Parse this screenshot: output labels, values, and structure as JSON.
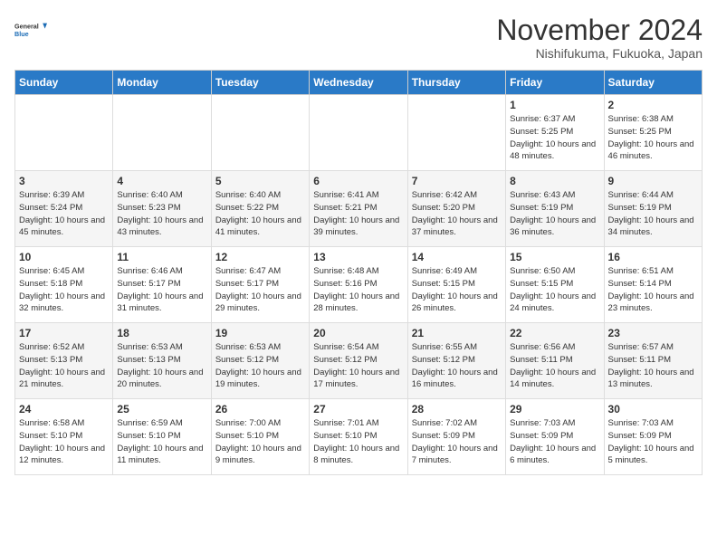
{
  "header": {
    "logo_line1": "General",
    "logo_line2": "Blue",
    "month": "November 2024",
    "location": "Nishifukuma, Fukuoka, Japan"
  },
  "days_of_week": [
    "Sunday",
    "Monday",
    "Tuesday",
    "Wednesday",
    "Thursday",
    "Friday",
    "Saturday"
  ],
  "weeks": [
    [
      {
        "day": "",
        "info": ""
      },
      {
        "day": "",
        "info": ""
      },
      {
        "day": "",
        "info": ""
      },
      {
        "day": "",
        "info": ""
      },
      {
        "day": "",
        "info": ""
      },
      {
        "day": "1",
        "info": "Sunrise: 6:37 AM\nSunset: 5:25 PM\nDaylight: 10 hours\nand 48 minutes."
      },
      {
        "day": "2",
        "info": "Sunrise: 6:38 AM\nSunset: 5:25 PM\nDaylight: 10 hours\nand 46 minutes."
      }
    ],
    [
      {
        "day": "3",
        "info": "Sunrise: 6:39 AM\nSunset: 5:24 PM\nDaylight: 10 hours\nand 45 minutes."
      },
      {
        "day": "4",
        "info": "Sunrise: 6:40 AM\nSunset: 5:23 PM\nDaylight: 10 hours\nand 43 minutes."
      },
      {
        "day": "5",
        "info": "Sunrise: 6:40 AM\nSunset: 5:22 PM\nDaylight: 10 hours\nand 41 minutes."
      },
      {
        "day": "6",
        "info": "Sunrise: 6:41 AM\nSunset: 5:21 PM\nDaylight: 10 hours\nand 39 minutes."
      },
      {
        "day": "7",
        "info": "Sunrise: 6:42 AM\nSunset: 5:20 PM\nDaylight: 10 hours\nand 37 minutes."
      },
      {
        "day": "8",
        "info": "Sunrise: 6:43 AM\nSunset: 5:19 PM\nDaylight: 10 hours\nand 36 minutes."
      },
      {
        "day": "9",
        "info": "Sunrise: 6:44 AM\nSunset: 5:19 PM\nDaylight: 10 hours\nand 34 minutes."
      }
    ],
    [
      {
        "day": "10",
        "info": "Sunrise: 6:45 AM\nSunset: 5:18 PM\nDaylight: 10 hours\nand 32 minutes."
      },
      {
        "day": "11",
        "info": "Sunrise: 6:46 AM\nSunset: 5:17 PM\nDaylight: 10 hours\nand 31 minutes."
      },
      {
        "day": "12",
        "info": "Sunrise: 6:47 AM\nSunset: 5:17 PM\nDaylight: 10 hours\nand 29 minutes."
      },
      {
        "day": "13",
        "info": "Sunrise: 6:48 AM\nSunset: 5:16 PM\nDaylight: 10 hours\nand 28 minutes."
      },
      {
        "day": "14",
        "info": "Sunrise: 6:49 AM\nSunset: 5:15 PM\nDaylight: 10 hours\nand 26 minutes."
      },
      {
        "day": "15",
        "info": "Sunrise: 6:50 AM\nSunset: 5:15 PM\nDaylight: 10 hours\nand 24 minutes."
      },
      {
        "day": "16",
        "info": "Sunrise: 6:51 AM\nSunset: 5:14 PM\nDaylight: 10 hours\nand 23 minutes."
      }
    ],
    [
      {
        "day": "17",
        "info": "Sunrise: 6:52 AM\nSunset: 5:13 PM\nDaylight: 10 hours\nand 21 minutes."
      },
      {
        "day": "18",
        "info": "Sunrise: 6:53 AM\nSunset: 5:13 PM\nDaylight: 10 hours\nand 20 minutes."
      },
      {
        "day": "19",
        "info": "Sunrise: 6:53 AM\nSunset: 5:12 PM\nDaylight: 10 hours\nand 19 minutes."
      },
      {
        "day": "20",
        "info": "Sunrise: 6:54 AM\nSunset: 5:12 PM\nDaylight: 10 hours\nand 17 minutes."
      },
      {
        "day": "21",
        "info": "Sunrise: 6:55 AM\nSunset: 5:12 PM\nDaylight: 10 hours\nand 16 minutes."
      },
      {
        "day": "22",
        "info": "Sunrise: 6:56 AM\nSunset: 5:11 PM\nDaylight: 10 hours\nand 14 minutes."
      },
      {
        "day": "23",
        "info": "Sunrise: 6:57 AM\nSunset: 5:11 PM\nDaylight: 10 hours\nand 13 minutes."
      }
    ],
    [
      {
        "day": "24",
        "info": "Sunrise: 6:58 AM\nSunset: 5:10 PM\nDaylight: 10 hours\nand 12 minutes."
      },
      {
        "day": "25",
        "info": "Sunrise: 6:59 AM\nSunset: 5:10 PM\nDaylight: 10 hours\nand 11 minutes."
      },
      {
        "day": "26",
        "info": "Sunrise: 7:00 AM\nSunset: 5:10 PM\nDaylight: 10 hours\nand 9 minutes."
      },
      {
        "day": "27",
        "info": "Sunrise: 7:01 AM\nSunset: 5:10 PM\nDaylight: 10 hours\nand 8 minutes."
      },
      {
        "day": "28",
        "info": "Sunrise: 7:02 AM\nSunset: 5:09 PM\nDaylight: 10 hours\nand 7 minutes."
      },
      {
        "day": "29",
        "info": "Sunrise: 7:03 AM\nSunset: 5:09 PM\nDaylight: 10 hours\nand 6 minutes."
      },
      {
        "day": "30",
        "info": "Sunrise: 7:03 AM\nSunset: 5:09 PM\nDaylight: 10 hours\nand 5 minutes."
      }
    ]
  ]
}
